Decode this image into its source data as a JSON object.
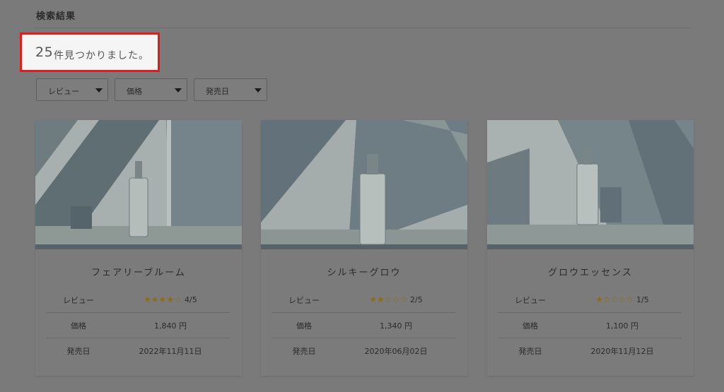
{
  "page": {
    "heading": "検索結果"
  },
  "results": {
    "count": "25",
    "text": "件見つかりました。"
  },
  "filters": [
    {
      "label": "レビュー"
    },
    {
      "label": "価格"
    },
    {
      "label": "発売日"
    }
  ],
  "row_labels": {
    "review": "レビュー",
    "price": "価格",
    "release": "発売日"
  },
  "products": [
    {
      "name": "フェアリーブルーム",
      "rating": 4,
      "rating_text": "4/5",
      "stars": "★★★★☆",
      "price": "1,840 円",
      "release_date": "2022年11月11日"
    },
    {
      "name": "シルキーグロウ",
      "rating": 2,
      "rating_text": "2/5",
      "stars": "★★☆☆☆",
      "price": "1,340 円",
      "release_date": "2020年06月02日"
    },
    {
      "name": "グロウエッセンス",
      "rating": 1,
      "rating_text": "1/5",
      "stars": "★☆☆☆☆",
      "price": "1,100 円",
      "release_date": "2020年11月12日"
    }
  ],
  "colors": {
    "highlight_border": "#e31b1b",
    "star": "#8e6d17",
    "overlay": "#7a7a7a"
  }
}
